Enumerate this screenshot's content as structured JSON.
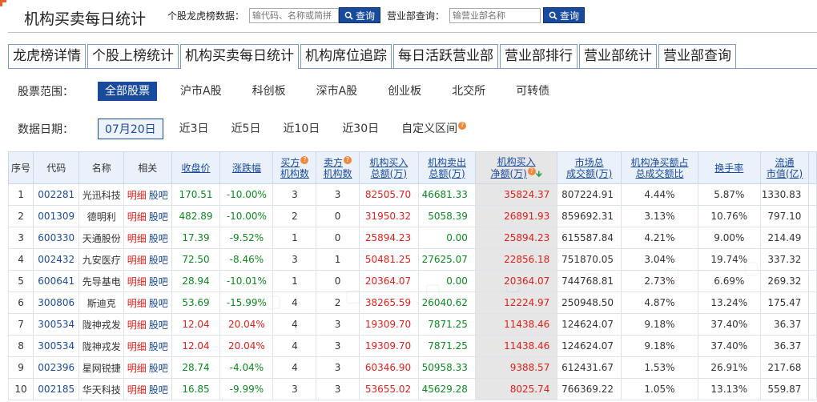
{
  "header": {
    "title": "机构买卖每日统计",
    "stock_search": {
      "label": "个股龙虎榜数据：",
      "placeholder": "输代码、名称或简拼",
      "button": "查询"
    },
    "dept_search": {
      "label": "营业部查询：",
      "placeholder": "输营业部名称",
      "button": "查询"
    }
  },
  "tabs": [
    "龙虎榜详情",
    "个股上榜统计",
    "机构买卖每日统计",
    "机构席位追踪",
    "每日活跃营业部",
    "营业部排行",
    "营业部统计",
    "营业部查询"
  ],
  "active_tab": 2,
  "filters": {
    "scope_label": "股票范围：",
    "scope_options": [
      "全部股票",
      "沪市A股",
      "科创板",
      "深市A股",
      "创业板",
      "北交所",
      "可转债"
    ],
    "scope_active": 0,
    "date_label": "数据日期：",
    "date_options": [
      "07月20日",
      "近3日",
      "近5日",
      "近10日",
      "近30日",
      "自定义区间"
    ],
    "date_active": 0
  },
  "table": {
    "headers": {
      "seq": "序号",
      "code": "代码",
      "name": "名称",
      "related": "相关",
      "close": "收盘价",
      "change": "涨跌幅",
      "buy_inst_1": "买方",
      "buy_inst_2": "机构数",
      "sell_inst_1": "卖方",
      "sell_inst_2": "机构数",
      "inst_buy_1": "机构买入",
      "inst_buy_2": "总额(万)",
      "inst_sell_1": "机构卖出",
      "inst_sell_2": "总额(万)",
      "inst_net_1": "机构买入",
      "inst_net_2": "净额(万)",
      "market_1": "市场总",
      "market_2": "成交额(万)",
      "ratio_1": "机构净买额占",
      "ratio_2": "总成交额比",
      "turnover": "换手率",
      "float_1": "流通",
      "float_2": "市值(亿)"
    },
    "related_labels": {
      "detail": "明细",
      "forum": "股吧"
    },
    "rows": [
      {
        "seq": "1",
        "code": "002281",
        "name": "光迅科技",
        "close": "170.51",
        "change": "-10.00%",
        "buy_n": "3",
        "sell_n": "3",
        "buy": "82505.70",
        "sell": "46681.33",
        "net": "35824.37",
        "market": "807224.91",
        "ratio": "4.44%",
        "turnover": "5.87%",
        "float": "1330.83"
      },
      {
        "seq": "2",
        "code": "001309",
        "name": "德明利",
        "close": "482.89",
        "change": "-10.00%",
        "buy_n": "2",
        "sell_n": "0",
        "buy": "31950.32",
        "sell": "5058.39",
        "net": "26891.93",
        "market": "859692.31",
        "ratio": "3.13%",
        "turnover": "10.76%",
        "float": "797.10"
      },
      {
        "seq": "3",
        "code": "600330",
        "name": "天通股份",
        "close": "17.39",
        "change": "-9.52%",
        "buy_n": "1",
        "sell_n": "0",
        "buy": "25894.23",
        "sell": "0.00",
        "net": "25894.23",
        "market": "615587.84",
        "ratio": "4.21%",
        "turnover": "9.00%",
        "float": "214.49"
      },
      {
        "seq": "4",
        "code": "002432",
        "name": "九安医疗",
        "close": "72.50",
        "change": "-8.46%",
        "buy_n": "3",
        "sell_n": "1",
        "buy": "50481.25",
        "sell": "27625.07",
        "net": "22856.18",
        "market": "751870.05",
        "ratio": "3.04%",
        "turnover": "19.74%",
        "float": "337.32"
      },
      {
        "seq": "5",
        "code": "600641",
        "name": "先导基电",
        "close": "28.94",
        "change": "-10.01%",
        "buy_n": "1",
        "sell_n": "0",
        "buy": "20364.07",
        "sell": "0.00",
        "net": "20364.07",
        "market": "744768.81",
        "ratio": "2.73%",
        "turnover": "6.69%",
        "float": "269.32"
      },
      {
        "seq": "6",
        "code": "300806",
        "name": "斯迪克",
        "close": "53.69",
        "change": "-15.99%",
        "buy_n": "4",
        "sell_n": "2",
        "buy": "38265.59",
        "sell": "26040.62",
        "net": "12224.97",
        "market": "250948.50",
        "ratio": "4.87%",
        "turnover": "13.24%",
        "float": "175.47"
      },
      {
        "seq": "7",
        "code": "300534",
        "name": "陇神戎发",
        "close": "12.04",
        "change": "20.04%",
        "buy_n": "4",
        "sell_n": "3",
        "buy": "19309.70",
        "sell": "7871.25",
        "net": "11438.46",
        "market": "124624.07",
        "ratio": "9.18%",
        "turnover": "37.40%",
        "float": "36.37"
      },
      {
        "seq": "8",
        "code": "300534",
        "name": "陇神戎发",
        "close": "12.04",
        "change": "20.04%",
        "buy_n": "4",
        "sell_n": "3",
        "buy": "19309.70",
        "sell": "7871.25",
        "net": "11438.46",
        "market": "124624.07",
        "ratio": "9.18%",
        "turnover": "37.40%",
        "float": "36.37"
      },
      {
        "seq": "9",
        "code": "002396",
        "name": "星网锐捷",
        "close": "28.74",
        "change": "-4.04%",
        "buy_n": "4",
        "sell_n": "3",
        "buy": "60346.90",
        "sell": "50958.33",
        "net": "9388.57",
        "market": "612431.67",
        "ratio": "1.53%",
        "turnover": "26.91%",
        "float": "217.68"
      },
      {
        "seq": "10",
        "code": "002185",
        "name": "华天科技",
        "close": "16.85",
        "change": "-9.99%",
        "buy_n": "3",
        "sell_n": "3",
        "buy": "53655.02",
        "sell": "45629.28",
        "net": "8025.74",
        "market": "766369.22",
        "ratio": "1.05%",
        "turnover": "13.13%",
        "float": "559.87"
      }
    ]
  },
  "colors": {
    "accent": "#1a4a9c",
    "up": "#e0201a",
    "down": "#0b8a1f",
    "corner": "#e8612c"
  },
  "icons": {
    "search_button": "search-icon",
    "help": "question-icon",
    "sort": "sort-down-icon"
  }
}
